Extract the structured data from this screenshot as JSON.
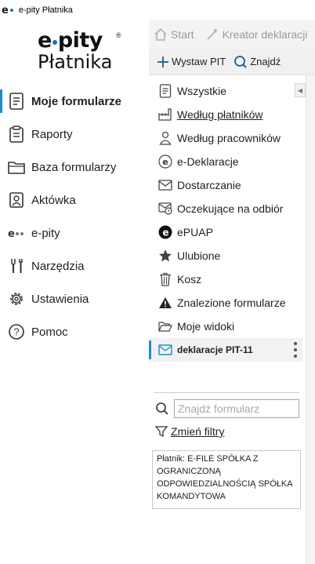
{
  "window": {
    "title": "e-pity Płatnika"
  },
  "logo": {
    "line1_left": "e",
    "line1_right": "pity",
    "registered": "®",
    "line2": "Płatnika"
  },
  "sidebar": {
    "items": [
      {
        "label": "Moje formularze",
        "icon": "document-icon",
        "active": true
      },
      {
        "label": "Raporty",
        "icon": "clipboard-icon"
      },
      {
        "label": "Baza formularzy",
        "icon": "folder-icon"
      },
      {
        "label": "Aktówka",
        "icon": "briefcase-user-icon"
      },
      {
        "label": "e-pity",
        "icon": "epity-logo-icon"
      },
      {
        "label": "Narzędzia",
        "icon": "tools-icon"
      },
      {
        "label": "Ustawienia",
        "icon": "gear-icon"
      },
      {
        "label": "Pomoc",
        "icon": "help-icon"
      }
    ]
  },
  "topbar": {
    "start": "Start",
    "wizard": "Kreator deklaracji"
  },
  "actionbar": {
    "new_pit": "Wystaw PIT",
    "find": "Znajdź"
  },
  "panel": {
    "items": [
      {
        "label": "Wszystkie",
        "icon": "list-icon"
      },
      {
        "label": "Według płatników",
        "icon": "factory-icon",
        "underlined": true
      },
      {
        "label": "Według pracowników",
        "icon": "person-icon"
      },
      {
        "label": "e-Deklaracje",
        "icon": "e-declaration-icon"
      },
      {
        "label": "Dostarczanie",
        "icon": "envelope-icon"
      },
      {
        "label": "Oczekujące na odbiór",
        "icon": "envelope-clock-icon"
      },
      {
        "label": "ePUAP",
        "icon": "epuap-icon"
      },
      {
        "label": "Ulubione",
        "icon": "star-icon"
      },
      {
        "label": "Kosz",
        "icon": "trash-icon"
      },
      {
        "label": "Znalezione formularze",
        "icon": "warning-icon"
      },
      {
        "label": "Moje widoki",
        "icon": "open-folder-icon"
      },
      {
        "label": "deklaracje PIT-11",
        "icon": "envelope-icon",
        "selected": true
      }
    ],
    "search_placeholder": "Znajdź formularz",
    "filter_label": "Zmień filtry",
    "info_text": "Płatnik: E-FILE SPÓŁKA Z OGRANICZONĄ ODPOWIEDZIALNOŚCIĄ SPÓŁKA KOMANDYTOWA"
  },
  "colors": {
    "accent": "#1a8fc8",
    "brand_dot": "#1a6fb5"
  }
}
